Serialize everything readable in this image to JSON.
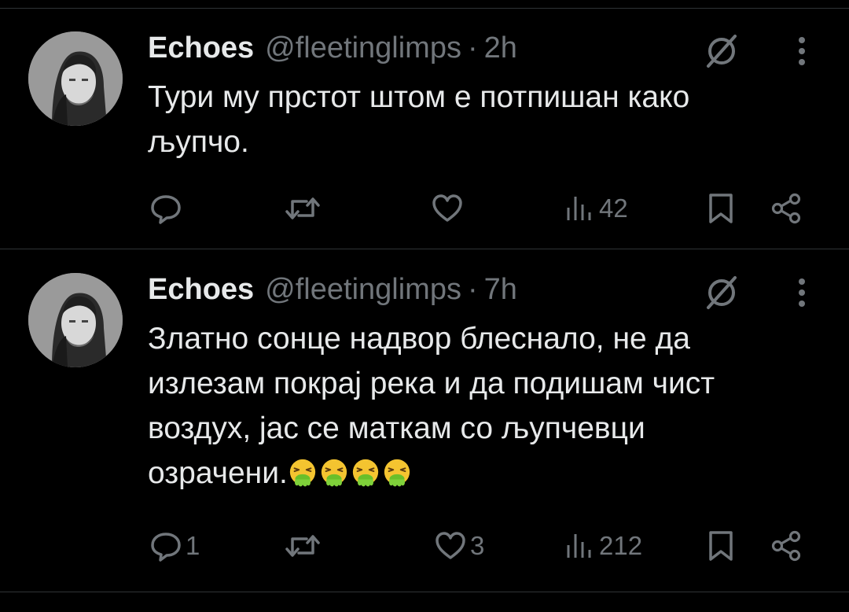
{
  "tweets": [
    {
      "display_name": "Echoes",
      "handle": "@fleetinglimps",
      "separator": "·",
      "time": "2h",
      "text_lines": [
        "Тури му прстот штом е потпишан како",
        "љупчо."
      ],
      "emoji_count": 0,
      "reply_count": "",
      "retweet_count": "",
      "like_count": "",
      "view_count": "42"
    },
    {
      "display_name": "Echoes",
      "handle": "@fleetinglimps",
      "separator": "·",
      "time": "7h",
      "text_lines": [
        "Златно сонце надвор блеснало, не да",
        "излезам покрај река и да подишам чист",
        "воздух, јас се маткам со љупчевци",
        "озрачени."
      ],
      "emoji_count": 4,
      "emoji": "vomiting-face-icon",
      "reply_count": "1",
      "retweet_count": "",
      "like_count": "3",
      "view_count": "212"
    }
  ],
  "colors": {
    "background": "#000000",
    "text": "#e7e9ea",
    "muted": "#71767b",
    "divider": "#2f3336"
  },
  "icons": {
    "menu": "more-vertical-icon",
    "grok": "grok-slash-icon",
    "reply": "reply-icon",
    "retweet": "retweet-icon",
    "like": "heart-icon",
    "views": "views-chart-icon",
    "bookmark": "bookmark-icon",
    "share": "share-icon"
  }
}
